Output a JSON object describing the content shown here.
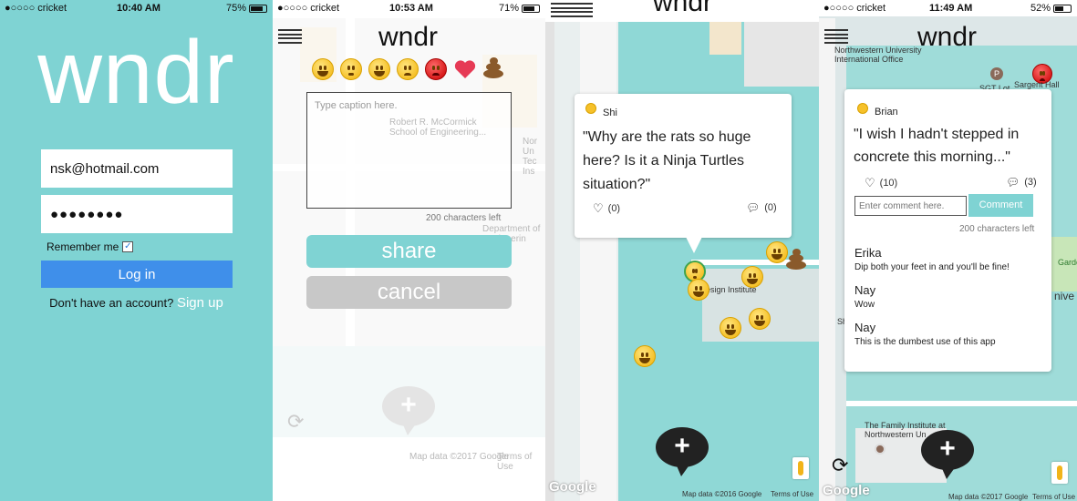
{
  "login_screen": {
    "status": {
      "carrier": "●○○○○ cricket",
      "time": "10:40 AM",
      "battery": "75%",
      "battery_level": 0.75
    },
    "logo": "wndr",
    "email_value": "nsk@hotmail.com",
    "password_value": "●●●●●●●●",
    "remember_label": "Remember me",
    "login_label": "Log in",
    "no_account_text": "Don't have an account?",
    "signup_label": "Sign up"
  },
  "compose_screen": {
    "status": {
      "carrier": "●○○○○ cricket",
      "time": "10:53 AM",
      "battery": "71%",
      "battery_level": 0.71
    },
    "title": "wndr",
    "reactions": [
      "grinning-face",
      "thinking-face",
      "tears-of-joy-face",
      "frowning-face",
      "angry-face",
      "heart",
      "pile-of-poo"
    ],
    "caption_placeholder": "Type caption here.",
    "char_count": "200 characters left",
    "share_label": "share",
    "cancel_label": "cancel",
    "map_labels": [
      "Robert R. McCormick School of Engineering...",
      "Nor Un Tec Ins",
      "Department of Engineerin Design",
      "Robert R. McCormick..."
    ],
    "faded_map_labels": [
      "Map data ©2017 Google",
      "Terms of Use"
    ],
    "colors": {
      "accent": "#7fd3d3",
      "cancel": "#c8c8c8"
    }
  },
  "map_screen": {
    "title": "wndr",
    "card": {
      "author": "Shi",
      "quote": "\"Why are the rats so huge here? Is it a Ninja Turtles situation?\"",
      "likes": "(0)",
      "comments": "(0)"
    },
    "map_label": "al Design Institute",
    "map_data": "Map data ©2016 Google",
    "terms": "Terms of Use",
    "google": "Google"
  },
  "comments_screen": {
    "status": {
      "carrier": "●○○○○ cricket",
      "time": "11:49 AM",
      "battery": "52%",
      "battery_level": 0.52
    },
    "title": "wndr",
    "map_labels": {
      "top": "Northwestern University International Office",
      "sgt": "SGT Lot",
      "sargent": "Sargent Hall",
      "family": "The Family Institute at Northwestern Un",
      "garden": "Garde",
      "univ": "nive",
      "sh": "Sh"
    },
    "card": {
      "author": "Brian",
      "quote": "\"I wish I hadn't stepped in concrete this morning...\"",
      "likes": "(10)",
      "comments": "(3)",
      "comment_placeholder": "Enter comment here.",
      "comment_button": "Comment",
      "char_count": "200 characters left",
      "comments_list": [
        {
          "name": "Erika",
          "text": "Dip both your feet in and you'll be fine!"
        },
        {
          "name": "Nay",
          "text": "Wow"
        },
        {
          "name": "Nay",
          "text": "This is the dumbest use of this app"
        }
      ]
    },
    "map_data": "Map data ©2017 Google",
    "terms": "Terms of Use",
    "google": "Google"
  }
}
